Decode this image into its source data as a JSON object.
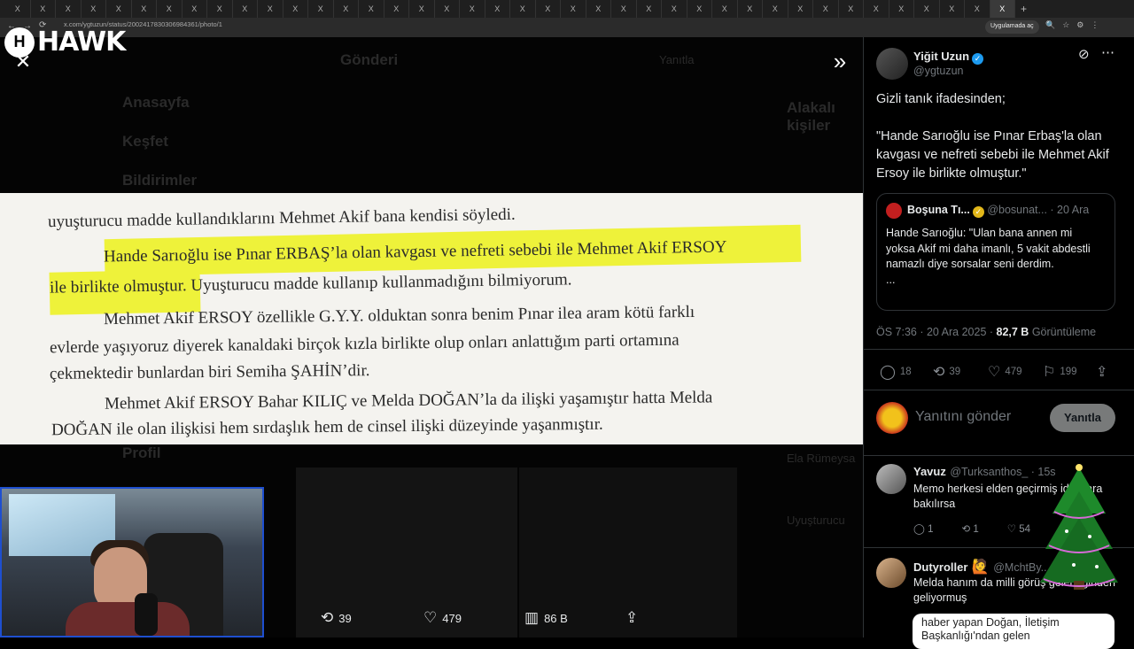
{
  "browser": {
    "tab_label": "X",
    "active_tab_label": "X",
    "new_tab": "+",
    "url": "x.com/ygtuzun/status/2002417830306984361/photo/1",
    "open_in_app": "Uygulamada aç"
  },
  "overlay_logo": {
    "mark": "H",
    "text": "HAWK"
  },
  "background_ghost": {
    "header_title": "Gönderi",
    "reply_label": "Yanıtla",
    "nav_home": "Anasayfa",
    "nav_explore": "Keşfet",
    "nav_notifications": "Bildirimler",
    "nav_profile": "Profil",
    "related_title": "Alakalı kişiler",
    "trend_1": "Ela Rümeysa",
    "trend_2": "Uyuşturucu"
  },
  "photo": {
    "lines": [
      "uyuşturucu madde kullandıklarını Mehmet Akif bana kendisi söyledi.",
      "Hande Sarıoğlu ise Pınar ERBAŞ’la olan kavgası ve nefreti sebebi ile Mehmet Akif ERSOY",
      "ile birlikte olmuştur. Uyuşturucu madde kullanıp kullanmadığını bilmiyorum.",
      "Mehmet Akif ERSOY özellikle G.Y.Y. olduktan sonra benim Pınar ilea aram kötü farklı",
      "evlerde yaşıyoruz diyerek kanaldaki birçok kızla birlikte olup onları anlattığım parti ortamına",
      "çekmektedir bunlardan biri Semiha ŞAHİN’dir.",
      "Mehmet Akif ERSOY Bahar KILIÇ ve Melda DOĞAN’la da ilişki yaşamıştır hatta Melda",
      "DOĞAN ile olan ilişkisi hem sırdaşlık hem de cinsel ilişki düzeyinde yaşanmıştır."
    ],
    "highlight_color": "#eef23a"
  },
  "bottom_bar": {
    "retweets": "39",
    "likes": "479",
    "views": "86 B"
  },
  "tweet": {
    "author_name": "Yiğit Uzun",
    "author_handle": "@ygtuzun",
    "text": "Gizli tanık ifadesinden;\n\n\"Hande Sarıoğlu ise Pınar Erbaş'la olan kavgası ve nefreti sebebi ile Mehmet Akif Ersoy ile birlikte olmuştur.\"",
    "quote": {
      "author_name": "Boşuna Tı...",
      "author_handle": "@bosunat...",
      "date": "· 20 Ara",
      "text": "Hande Sarıoğlu: \"Ulan bana annen mi yoksa Akif mi daha imanlı, 5 vakit abdestli namazlı diye sorsalar seni derdim.\n..."
    },
    "timestamp": "ÖS 7:36 · 20 Ara 2025 · ",
    "views_count": "82,7 B",
    "views_label": " Görüntüleme",
    "stats": {
      "replies": "18",
      "retweets": "39",
      "likes": "479",
      "bookmarks": "199"
    }
  },
  "composer": {
    "placeholder": "Yanıtını gönder",
    "button": "Yanıtla"
  },
  "replies": [
    {
      "name": "Yavuz",
      "handle": "@Turksanthos_ · 15s",
      "text": "Memo herkesi elden geçirmiş iddialara bakılırsa",
      "replies": "1",
      "retweets": "1",
      "likes": "54"
    },
    {
      "name": "Dutyroller",
      "handle": "@MchtBy...",
      "text": "Melda hanım da milli görüş geleneğinden geliyormuş",
      "card_text": "haber yapan Doğan, İletişim Başkanlığı'ndan gelen"
    }
  ],
  "colors": {
    "accent": "#1d9bf0",
    "gold_badge": "#e2b719",
    "webcam_border": "#1e4fd0"
  }
}
